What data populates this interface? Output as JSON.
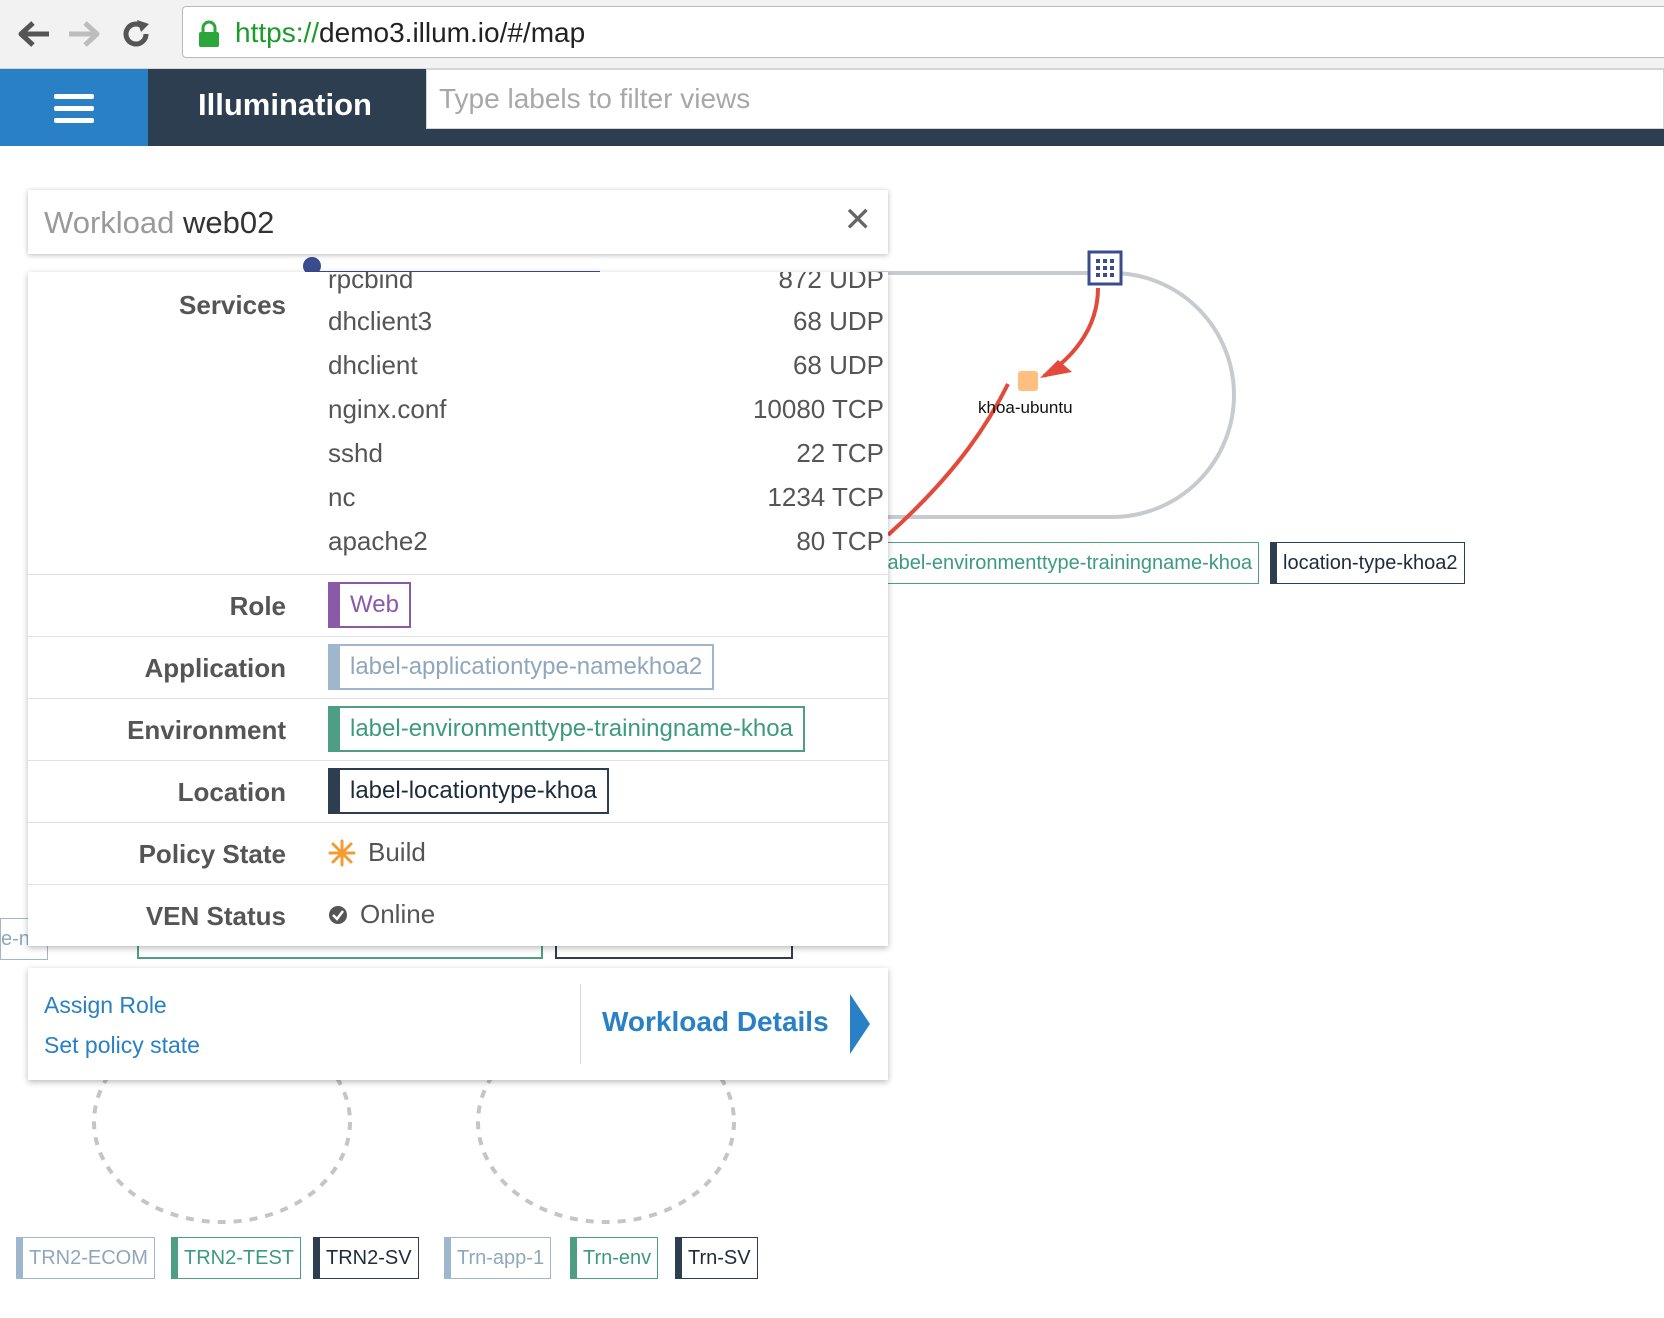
{
  "browser": {
    "url_scheme": "https://",
    "url_rest": "demo3.illum.io/#/map"
  },
  "header": {
    "app_title": "Illumination",
    "filter_placeholder": "Type labels to filter views"
  },
  "map": {
    "node_label": "khoa-ubuntu",
    "group_labels": [
      {
        "text": "label-environmenttype-trainingname-khoa",
        "kind": "env"
      },
      {
        "text": "location-type-khoa2",
        "kind": "loc"
      }
    ],
    "bottom_labels": [
      {
        "text": "TRN2-ECOM",
        "kind": "app"
      },
      {
        "text": "TRN2-TEST",
        "kind": "env"
      },
      {
        "text": "TRN2-SV",
        "kind": "loc"
      },
      {
        "text": "Trn-app-1",
        "kind": "app"
      },
      {
        "text": "Trn-env",
        "kind": "env"
      },
      {
        "text": "Trn-SV",
        "kind": "loc"
      }
    ],
    "partial_left_label": "e-na",
    "colors": {
      "edge": "#e24a3b",
      "node": "#ffbf80",
      "ring": "#c5cbcf",
      "workload_icon": "#3b4c8e"
    }
  },
  "panel": {
    "kind": "Workload",
    "name": "web02",
    "services_label": "Services",
    "services": [
      {
        "name": "rpcbind",
        "port": "872 UDP"
      },
      {
        "name": "dhclient3",
        "port": "68 UDP"
      },
      {
        "name": "dhclient",
        "port": "68 UDP"
      },
      {
        "name": "nginx.conf",
        "port": "10080 TCP"
      },
      {
        "name": "sshd",
        "port": "22 TCP"
      },
      {
        "name": "nc",
        "port": "1234 TCP"
      },
      {
        "name": "apache2",
        "port": "80 TCP"
      }
    ],
    "role_label": "Role",
    "role_value": "Web",
    "application_label": "Application",
    "application_value": "label-applicationtype-namekhoa2",
    "environment_label": "Environment",
    "environment_value": "label-environmenttype-trainingname-khoa",
    "location_label": "Location",
    "location_value": "label-locationtype-khoa",
    "policy_label": "Policy State",
    "policy_value": "Build",
    "ven_label": "VEN Status",
    "ven_value": "Online",
    "colors": {
      "role": "#8a5aa8",
      "application": "#9eb7cc",
      "environment": "#4e9e86",
      "location": "#2c3e50",
      "build": "#f39c32",
      "link": "#2980c4"
    }
  },
  "footer": {
    "assign_role": "Assign Role",
    "set_policy": "Set policy state",
    "details": "Workload Details"
  }
}
